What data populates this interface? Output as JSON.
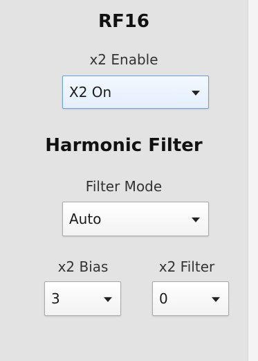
{
  "section": {
    "title": "RF16"
  },
  "x2_enable": {
    "label": "x2 Enable",
    "value": "X2 On"
  },
  "harmonic_filter": {
    "title": "Harmonic Filter",
    "filter_mode": {
      "label": "Filter Mode",
      "value": "Auto"
    },
    "x2_bias": {
      "label": "x2 Bias",
      "value": "3"
    },
    "x2_filter": {
      "label": "x2 Filter",
      "value": "0"
    }
  },
  "icons": {
    "dropdown": "chevron-down-icon"
  },
  "colors": {
    "panel_background": "#e3e3e3",
    "focused_border": "#6c9ed8",
    "dropdown_border": "#a9a9a9"
  }
}
